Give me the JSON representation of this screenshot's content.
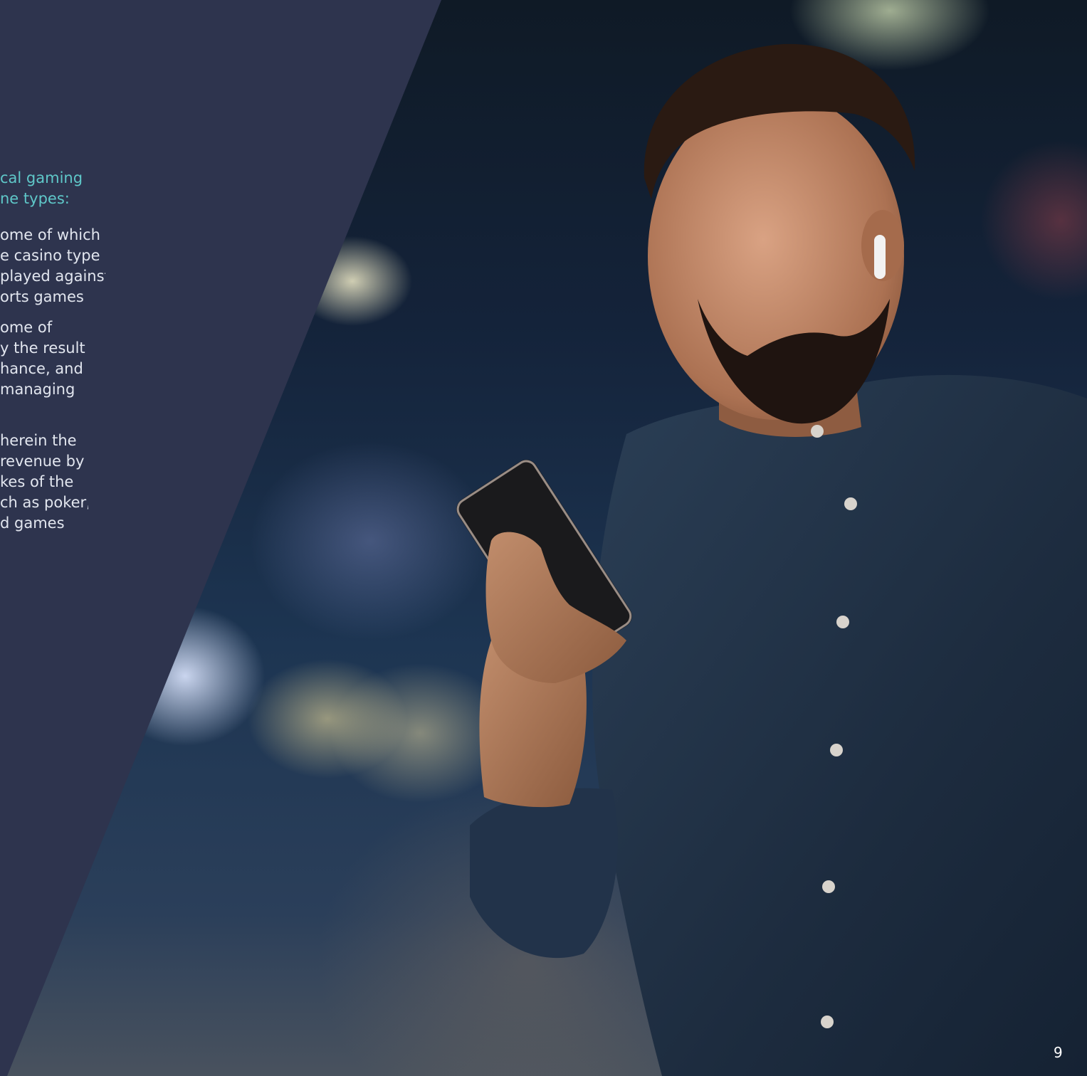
{
  "heading": {
    "lines": [
      "cal gaming",
      "ne types:"
    ]
  },
  "paragraphs": [
    {
      "lines": [
        "ome of which",
        "e casino type",
        "played against",
        "orts games"
      ]
    },
    {
      "lines": [
        "ome of",
        "y the result",
        "hance, and",
        "managing"
      ]
    },
    {
      "lines": [
        "herein the",
        "revenue by",
        "kes of the",
        "ch as poker,",
        "d games"
      ]
    }
  ],
  "page_number": "9",
  "colors": {
    "panel": "#2e344e",
    "heading_accent": "#5fc8c9",
    "body_text": "#e2e6ef"
  }
}
